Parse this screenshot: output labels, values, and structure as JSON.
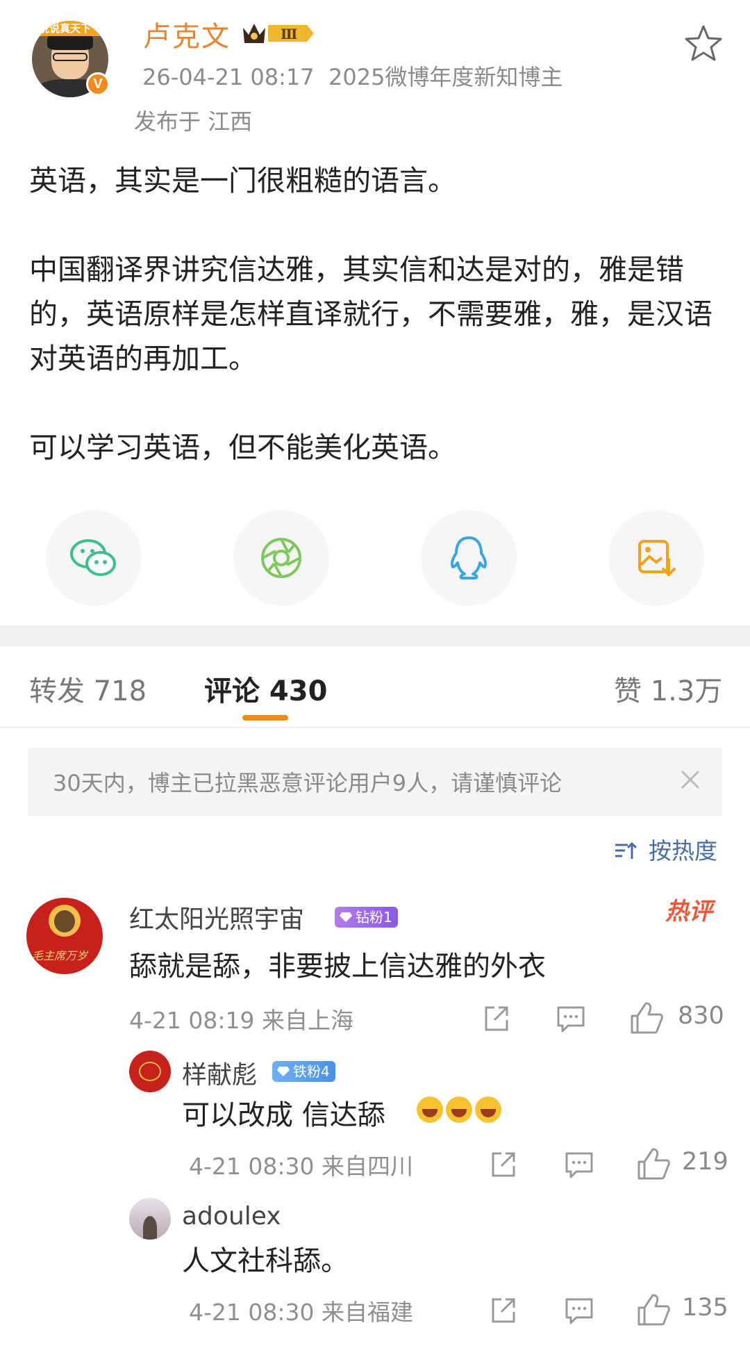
{
  "post": {
    "author": "卢克文",
    "author_level": "Ⅲ",
    "avatar_banner": "说说真天下",
    "time": "26-04-21 08:17",
    "title_badge": "2025微博年度新知博主",
    "location": "发布于 江西",
    "paragraphs": [
      "英语，其实是一门很粗糙的语言。",
      "中国翻译界讲究信达雅，其实信和达是对的，雅是错的，英语原样是怎样直译就行，不需要雅，雅，是汉语对英语的再加工。",
      "可以学习英语，但不能美化英语。"
    ]
  },
  "share": {
    "wechat": "wechat-icon",
    "moments": "moments-icon",
    "qq": "qq-icon",
    "save_image": "save-image-icon"
  },
  "tabs": {
    "repost": "转发 718",
    "comments": "评论 430",
    "likes": "赞 1.3万"
  },
  "notice": "30天内，博主已拉黑恶意评论用户9人，请谨慎评论",
  "sort_label": "按热度",
  "comments": [
    {
      "name": "红太阳光照宇宙",
      "badge": "钻粉1",
      "hot": "热评",
      "text": "舔就是舔，非要披上信达雅的外衣",
      "time": "4-21 08:19 来自上海",
      "likes": "830",
      "avatar_text": "毛主席万岁"
    },
    {
      "name": "样献彪",
      "badge": "铁粉4",
      "text": "可以改成 信达舔",
      "time": "4-21 08:30 来自四川",
      "likes": "219"
    },
    {
      "name": "adoulex",
      "text": "人文社科舔。",
      "time": "4-21 08:30 来自福建",
      "likes": "135"
    }
  ],
  "colors": {
    "author": "#e8842e",
    "accent": "#ee8b1e",
    "link": "#4a6ca6",
    "hot": "#e85a3a"
  }
}
